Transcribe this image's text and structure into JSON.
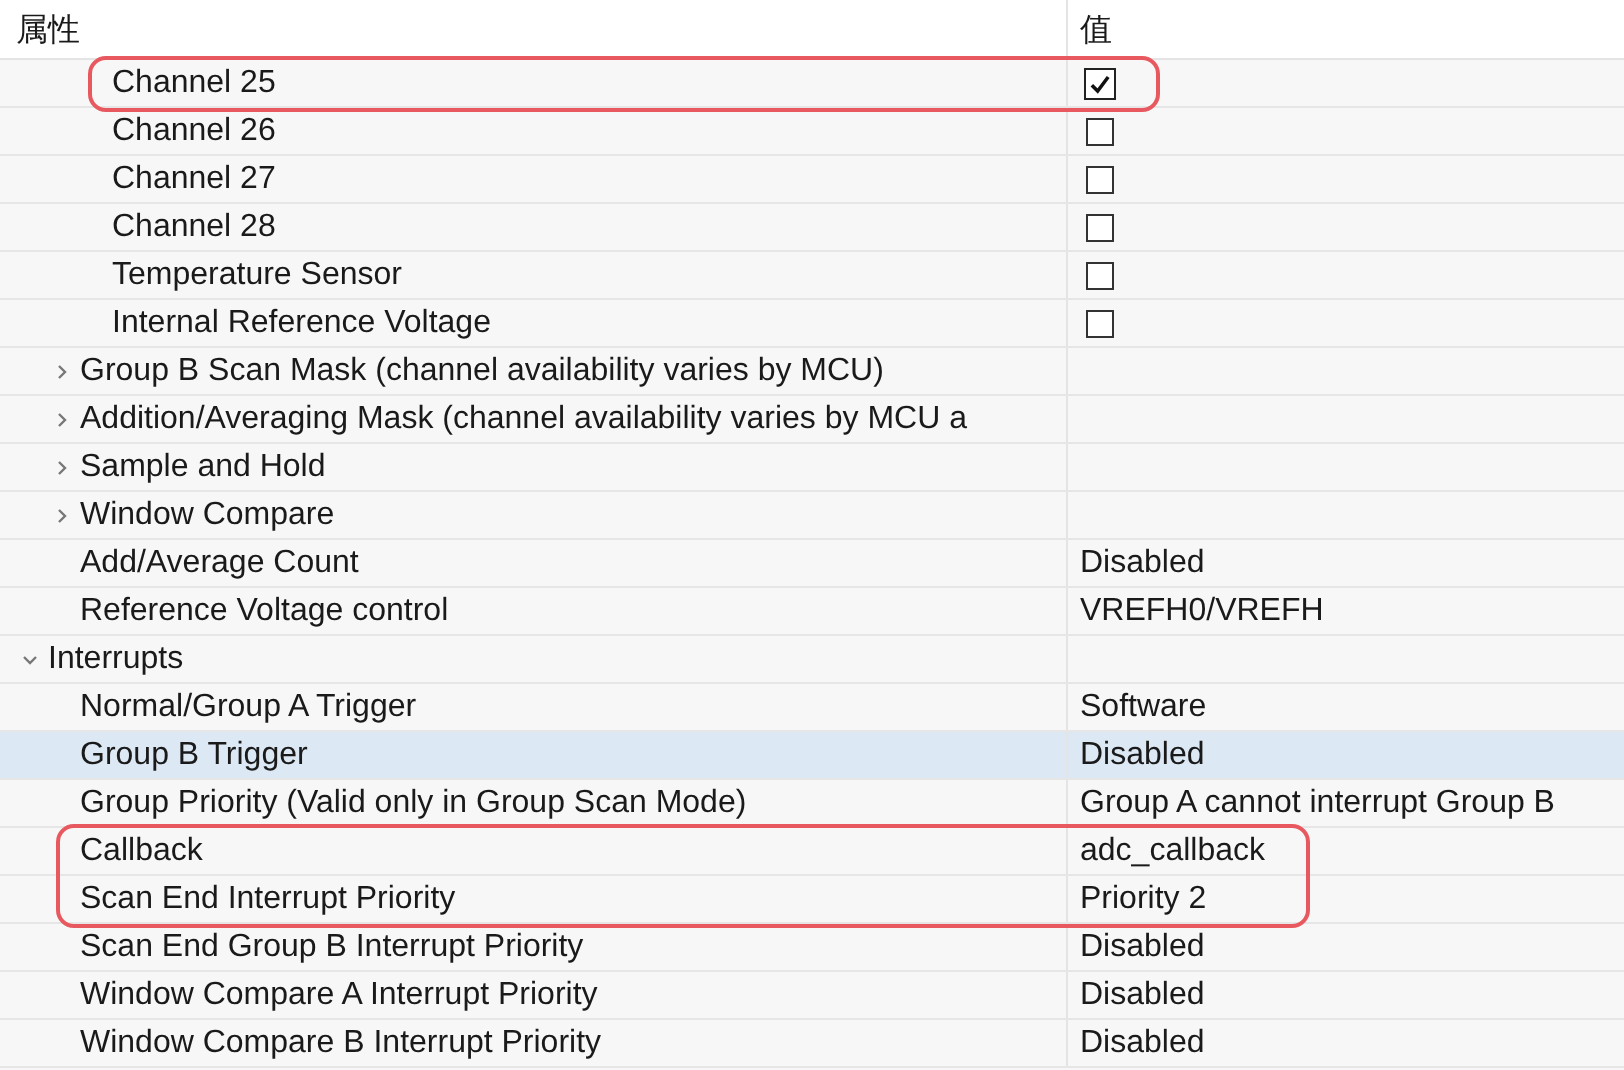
{
  "columns": [
    "属性",
    "值"
  ],
  "properties": [
    {
      "children": [
        {
          "children": [
            {
              "label": "Channel 25",
              "kind": "checkbox",
              "checked": true,
              "selected": false,
              "boxed": true
            },
            {
              "label": "Channel 26",
              "kind": "checkbox",
              "checked": false,
              "selected": false,
              "boxed": false
            },
            {
              "label": "Channel 27",
              "kind": "checkbox",
              "checked": false,
              "selected": false,
              "boxed": false
            },
            {
              "label": "Channel 28",
              "kind": "checkbox",
              "checked": false,
              "selected": false,
              "boxed": false
            },
            {
              "label": "Temperature Sensor",
              "kind": "checkbox",
              "checked": false,
              "selected": false,
              "boxed": false
            },
            {
              "label": "Internal Reference Voltage",
              "kind": "checkbox",
              "checked": false,
              "selected": false,
              "boxed": false
            }
          ]
        },
        {
          "label": "Group B Scan Mask (channel availability varies by MCU)",
          "kind": "group",
          "expanded": false,
          "selected": false,
          "boxed": false
        },
        {
          "label": "Addition/Averaging Mask (channel availability varies by MCU a",
          "kind": "group",
          "expanded": false,
          "selected": false,
          "boxed": false
        },
        {
          "label": "Sample and Hold",
          "kind": "group",
          "expanded": false,
          "selected": false,
          "boxed": false
        },
        {
          "label": "Window Compare",
          "kind": "group",
          "expanded": false,
          "selected": false,
          "boxed": false
        },
        {
          "label": "Add/Average Count",
          "kind": "text",
          "value": "Disabled",
          "selected": false,
          "boxed": false
        },
        {
          "label": "Reference Voltage control",
          "kind": "text",
          "value": "VREFH0/VREFH",
          "selected": false,
          "boxed": false
        }
      ]
    },
    {
      "label": "Interrupts",
      "kind": "group",
      "expanded": true,
      "selected": false,
      "boxed": false,
      "children": [
        {
          "label": "Normal/Group A Trigger",
          "kind": "text",
          "value": "Software",
          "selected": false,
          "boxed": false
        },
        {
          "label": "Group B Trigger",
          "kind": "text",
          "value": "Disabled",
          "selected": true,
          "boxed": false
        },
        {
          "label": "Group Priority (Valid only in Group Scan Mode)",
          "kind": "text",
          "value": "Group A cannot interrupt Group B",
          "selected": false,
          "boxed": false
        },
        {
          "label": "Callback",
          "kind": "text",
          "value": "adc_callback",
          "selected": false,
          "boxed": true
        },
        {
          "label": "Scan End Interrupt Priority",
          "kind": "text",
          "value": "Priority 2",
          "selected": false,
          "boxed": true
        },
        {
          "label": "Scan End Group B Interrupt Priority",
          "kind": "text",
          "value": "Disabled",
          "selected": false,
          "boxed": false
        },
        {
          "label": "Window Compare A Interrupt Priority",
          "kind": "text",
          "value": "Disabled",
          "selected": false,
          "boxed": false
        },
        {
          "label": "Window Compare B Interrupt Priority",
          "kind": "text",
          "value": "Disabled",
          "selected": false,
          "boxed": false
        }
      ]
    }
  ]
}
